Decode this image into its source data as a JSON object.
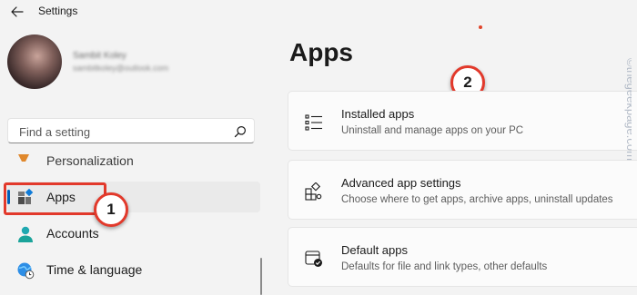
{
  "window": {
    "title": "Settings"
  },
  "profile": {
    "name": "Sambit Koley",
    "email": "sambitkoley@outlook.com"
  },
  "search": {
    "placeholder": "Find a setting"
  },
  "nav": {
    "partial_label": "Personalization",
    "items": [
      {
        "label": "Apps",
        "icon": "apps-icon",
        "selected": true
      },
      {
        "label": "Accounts",
        "icon": "person-icon",
        "selected": false
      },
      {
        "label": "Time & language",
        "icon": "globe-clock-icon",
        "selected": false
      }
    ]
  },
  "main": {
    "heading": "Apps",
    "cards": [
      {
        "title": "Installed apps",
        "description": "Uninstall and manage apps on your PC",
        "icon": "list-icon"
      },
      {
        "title": "Advanced app settings",
        "description": "Choose where to get apps, archive apps, uninstall updates",
        "icon": "app-settings-icon"
      },
      {
        "title": "Default apps",
        "description": "Defaults for file and link types, other defaults",
        "icon": "default-apps-icon"
      }
    ]
  },
  "annotations": {
    "callout_1": "1",
    "callout_2": "2"
  },
  "watermark": "©thegeekpage.com",
  "colors": {
    "accent": "#005fb8",
    "annotation_red": "#e2392b",
    "background": "#f3f3f3",
    "card": "#fbfbfb"
  }
}
